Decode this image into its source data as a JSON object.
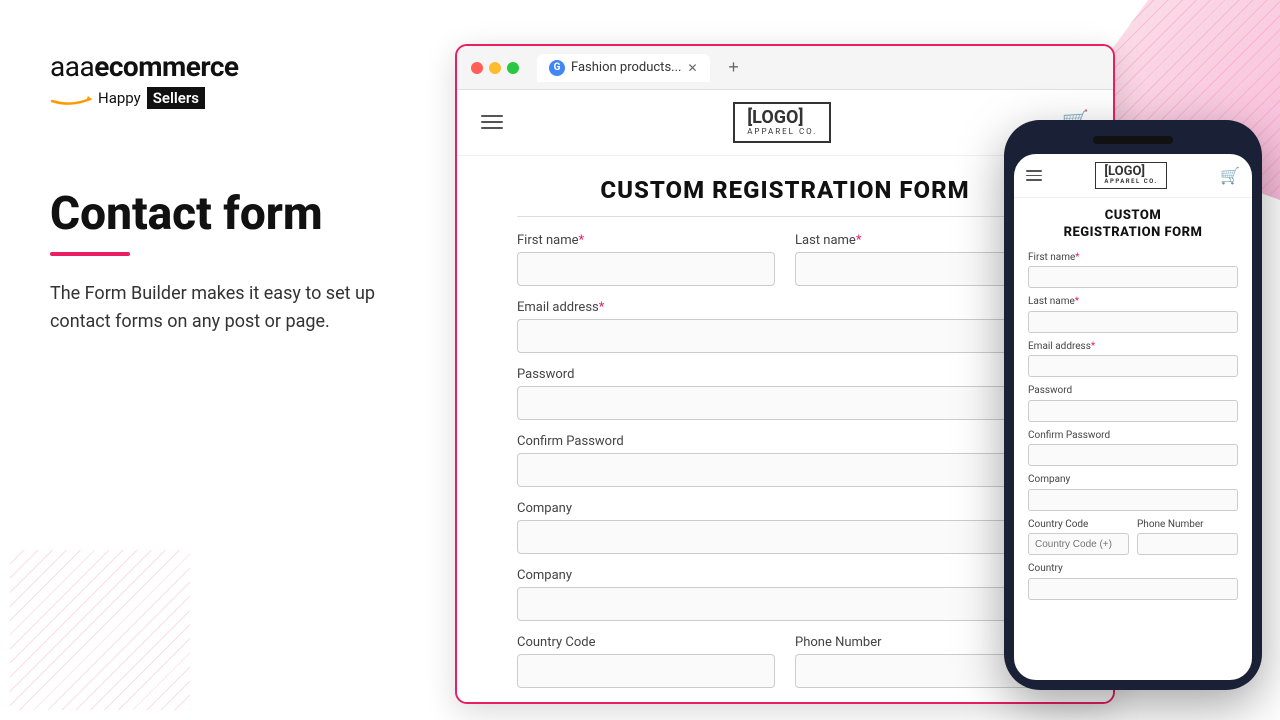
{
  "brand": {
    "name_prefix": "aaa",
    "name_main": "ecommerce",
    "tagline_happy": "Happy",
    "tagline_sellers": "Sellers"
  },
  "left": {
    "heading": "Contact form",
    "description": "The Form Builder makes it easy to set up contact forms on any post or page."
  },
  "browser": {
    "tab_label": "Fashion products...",
    "new_tab_label": "+",
    "logo_text": "[LOGO]",
    "logo_sub": "APPAREL CO.",
    "form_title": "CUSTOM REGISTRATION FORM",
    "fields": [
      {
        "label": "First name",
        "required": true,
        "id": "first-name"
      },
      {
        "label": "Last name",
        "required": true,
        "id": "last-name"
      },
      {
        "label": "Email address",
        "required": true,
        "id": "email"
      },
      {
        "label": "Password",
        "required": false,
        "id": "password"
      },
      {
        "label": "Confirm Password",
        "required": false,
        "id": "confirm-password"
      },
      {
        "label": "Company",
        "required": false,
        "id": "company"
      },
      {
        "label": "Company",
        "required": false,
        "id": "company2"
      },
      {
        "label": "Country Code",
        "required": false,
        "id": "country-code"
      },
      {
        "label": "Phone Number",
        "required": false,
        "id": "phone"
      }
    ]
  },
  "mobile": {
    "logo_text": "[LOGO]",
    "logo_sub": "APPAREL CO.",
    "form_title": "CUSTOM\nREGISTRATION FORM",
    "fields": [
      {
        "label": "First name",
        "required": true
      },
      {
        "label": "Last name",
        "required": true
      },
      {
        "label": "Email address",
        "required": true
      },
      {
        "label": "Password",
        "required": false
      },
      {
        "label": "Confirm Password",
        "required": false
      },
      {
        "label": "Company",
        "required": false
      },
      {
        "label": "Country Code",
        "required": false
      },
      {
        "label": "Phone Number",
        "required": false
      },
      {
        "label": "Country",
        "required": false
      }
    ]
  }
}
